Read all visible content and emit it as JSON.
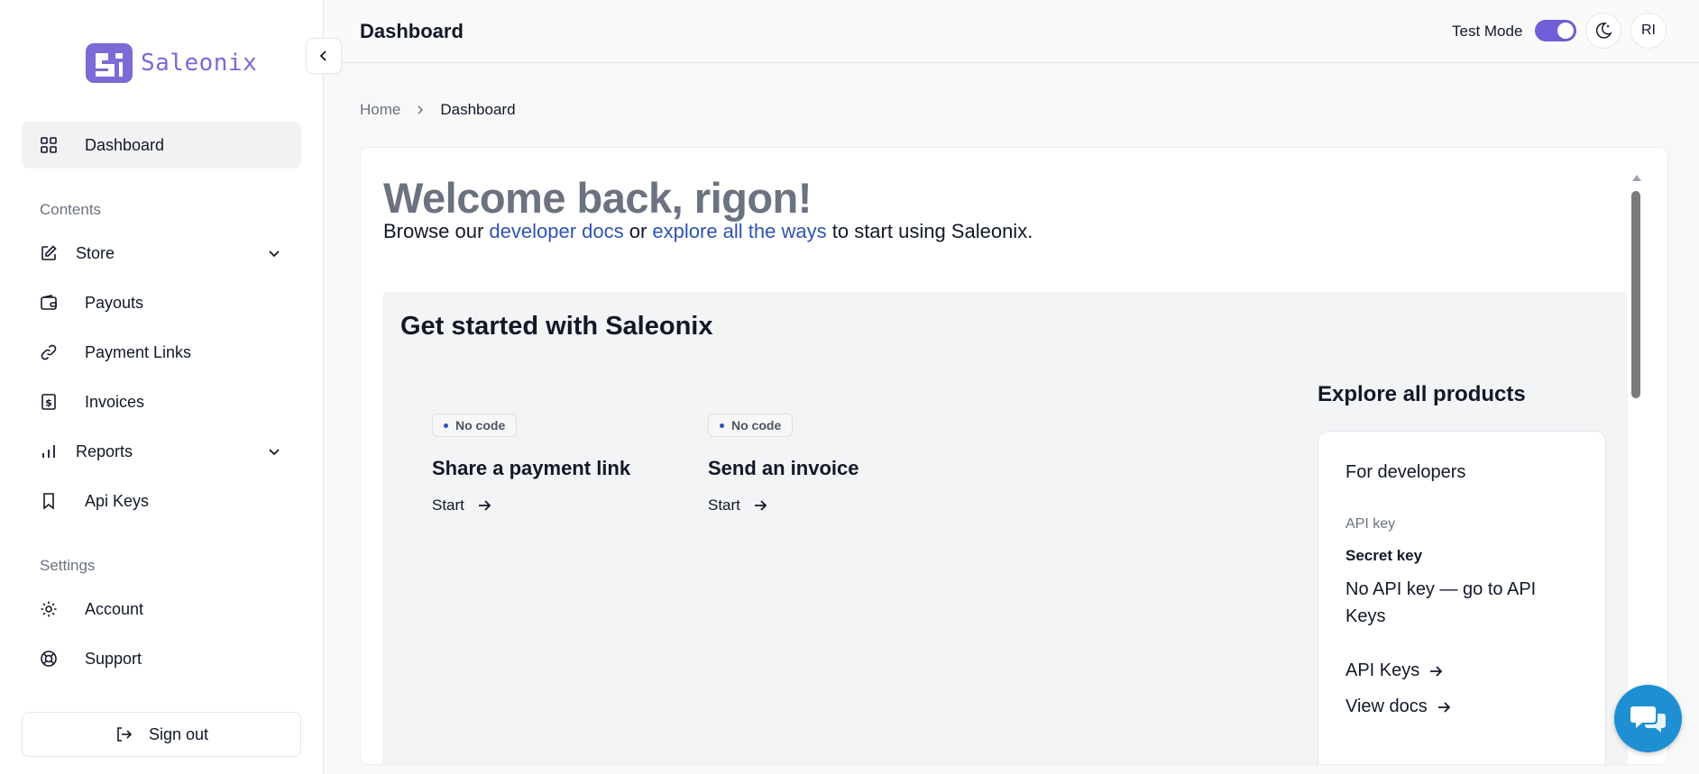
{
  "app": {
    "logo_text": "Saleonix",
    "colors": {
      "brand": "#7c6ad6",
      "accent": "#6c5fd8",
      "link": "#2f53b5",
      "chat": "#1f8fd3"
    }
  },
  "sidebar": {
    "collapse_icon": "chevron-left-icon",
    "items": [
      {
        "label": "Dashboard",
        "icon": "grid-icon",
        "active": true
      }
    ],
    "sections": [
      {
        "label": "Contents",
        "items": [
          {
            "label": "Store",
            "icon": "edit-icon",
            "expandable": true
          },
          {
            "label": "Payouts",
            "icon": "wallet-icon"
          },
          {
            "label": "Payment Links",
            "icon": "link-icon"
          },
          {
            "label": "Invoices",
            "icon": "invoice-icon"
          },
          {
            "label": "Reports",
            "icon": "bar-chart-icon",
            "expandable": true
          },
          {
            "label": "Api Keys",
            "icon": "bookmark-icon"
          }
        ]
      },
      {
        "label": "Settings",
        "items": [
          {
            "label": "Account",
            "icon": "gear-icon"
          },
          {
            "label": "Support",
            "icon": "lifebuoy-icon"
          }
        ]
      }
    ],
    "sign_out_label": "Sign out"
  },
  "header": {
    "title": "Dashboard",
    "test_mode_label": "Test Mode",
    "test_mode_on": true,
    "theme_icon": "moon-icon",
    "avatar_initials": "RI"
  },
  "breadcrumb": {
    "home": "Home",
    "current": "Dashboard"
  },
  "main": {
    "welcome": "Welcome back, rigon!",
    "browse": {
      "prefix": "Browse our ",
      "link1": "developer docs",
      "middle": " or ",
      "link2": "explore all the ways",
      "suffix": " to start using Saleonix."
    },
    "get_started": {
      "title": "Get started with Saleonix",
      "tasks": [
        {
          "badge": "No code",
          "title": "Share a payment link",
          "action": "Start"
        },
        {
          "badge": "No code",
          "title": "Send an invoice",
          "action": "Start"
        }
      ]
    },
    "explore": {
      "title": "Explore all products",
      "card": {
        "title": "For developers",
        "api_key_label": "API key",
        "secret_label": "Secret key",
        "secret_value": "No API key — go to API Keys",
        "links": [
          "API Keys",
          "View docs"
        ]
      }
    }
  }
}
